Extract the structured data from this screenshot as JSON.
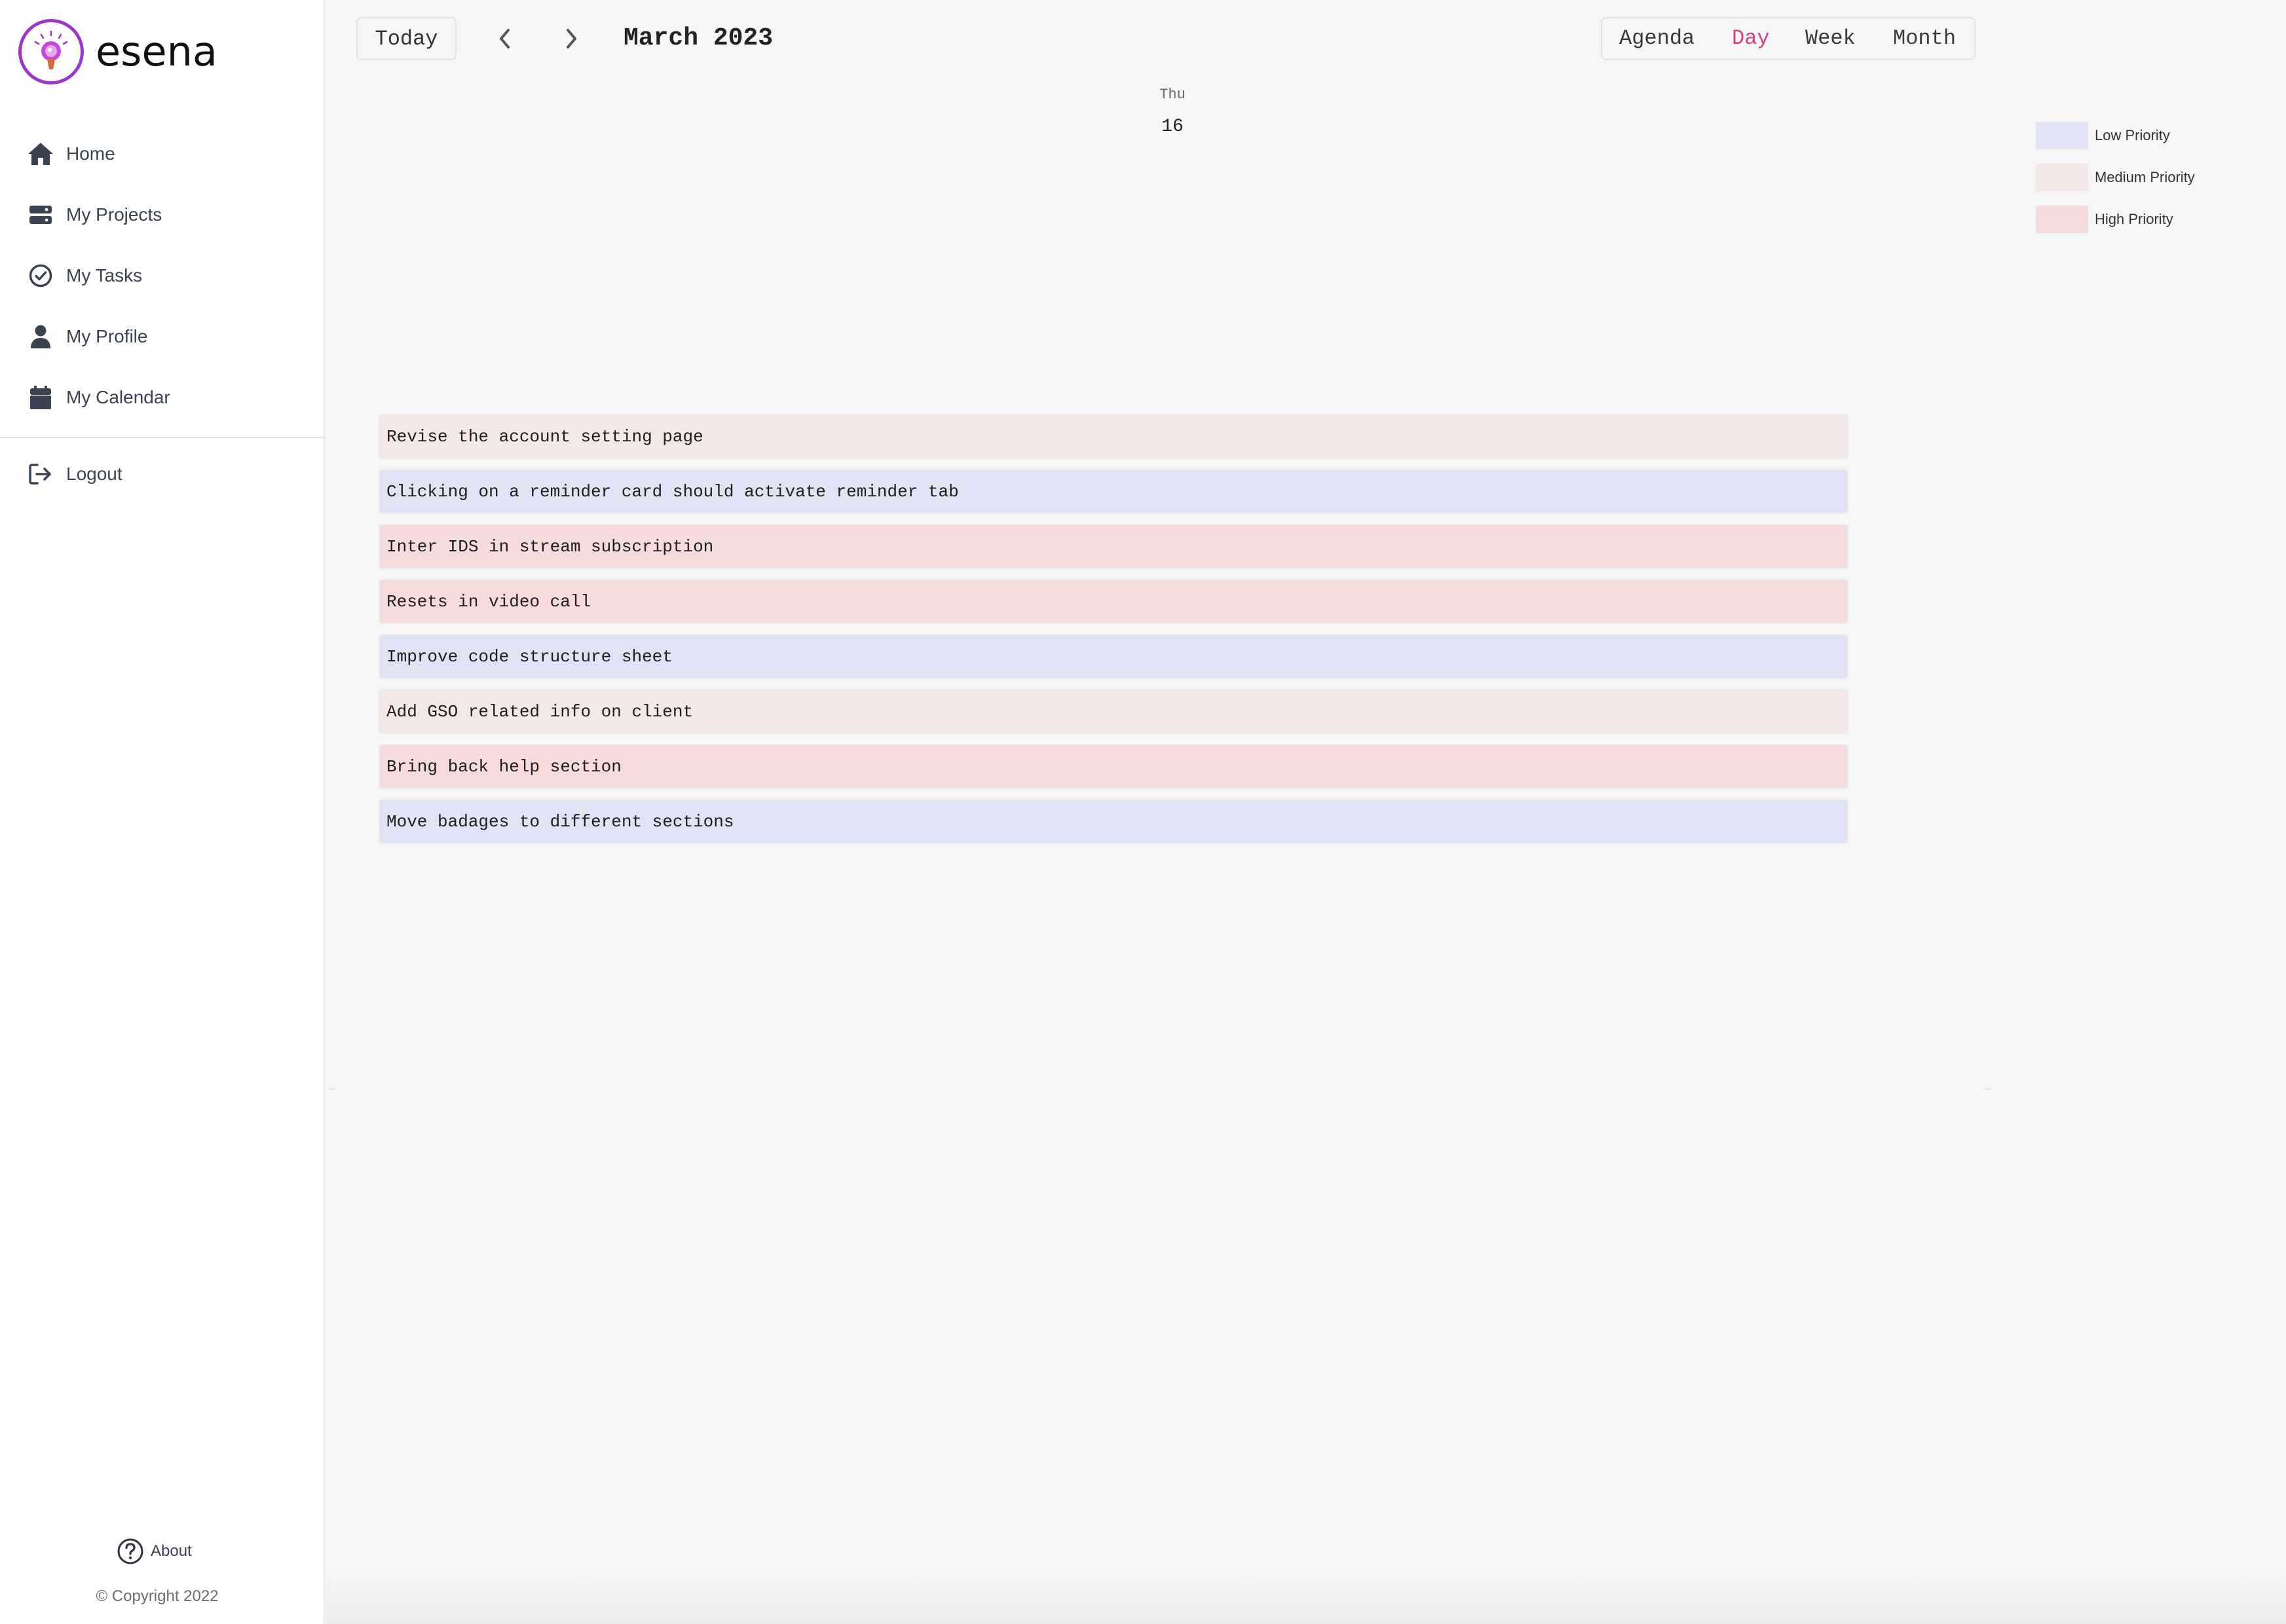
{
  "app": {
    "name": "esena"
  },
  "sidebar": {
    "items": [
      {
        "label": "Home",
        "icon": "home-icon"
      },
      {
        "label": "My Projects",
        "icon": "projects-icon"
      },
      {
        "label": "My Tasks",
        "icon": "check-circle-icon"
      },
      {
        "label": "My Profile",
        "icon": "user-icon"
      },
      {
        "label": "My Calendar",
        "icon": "calendar-icon"
      }
    ],
    "logout": {
      "label": "Logout",
      "icon": "logout-icon"
    },
    "about": {
      "label": "About",
      "icon": "question-circle-icon"
    },
    "copyright": "© Copyright 2022"
  },
  "toolbar": {
    "today_label": "Today",
    "month_title": "March 2023",
    "views": [
      "Agenda",
      "Day",
      "Week",
      "Month"
    ],
    "active_view": "Day"
  },
  "day": {
    "weekday": "Thu",
    "date": "16"
  },
  "events": [
    {
      "title": "Revise the account setting page",
      "priority": "medium"
    },
    {
      "title": "Clicking on a reminder card should activate reminder tab",
      "priority": "low"
    },
    {
      "title": "Inter IDS in stream subscription",
      "priority": "high"
    },
    {
      "title": "Resets in video call",
      "priority": "high"
    },
    {
      "title": "Improve code structure sheet",
      "priority": "low"
    },
    {
      "title": "Add GSO related info on client",
      "priority": "medium"
    },
    {
      "title": "Bring back help section",
      "priority": "high"
    },
    {
      "title": "Move badages to different sections",
      "priority": "low"
    }
  ],
  "legend": [
    {
      "label": "Low Priority",
      "color": "#dfe3f4"
    },
    {
      "label": "Medium Priority",
      "color": "#f3e8e5"
    },
    {
      "label": "High Priority",
      "color": "#f5dbdc"
    }
  ],
  "colors": {
    "accent": "#d64080",
    "brand": "#9b37c9"
  }
}
